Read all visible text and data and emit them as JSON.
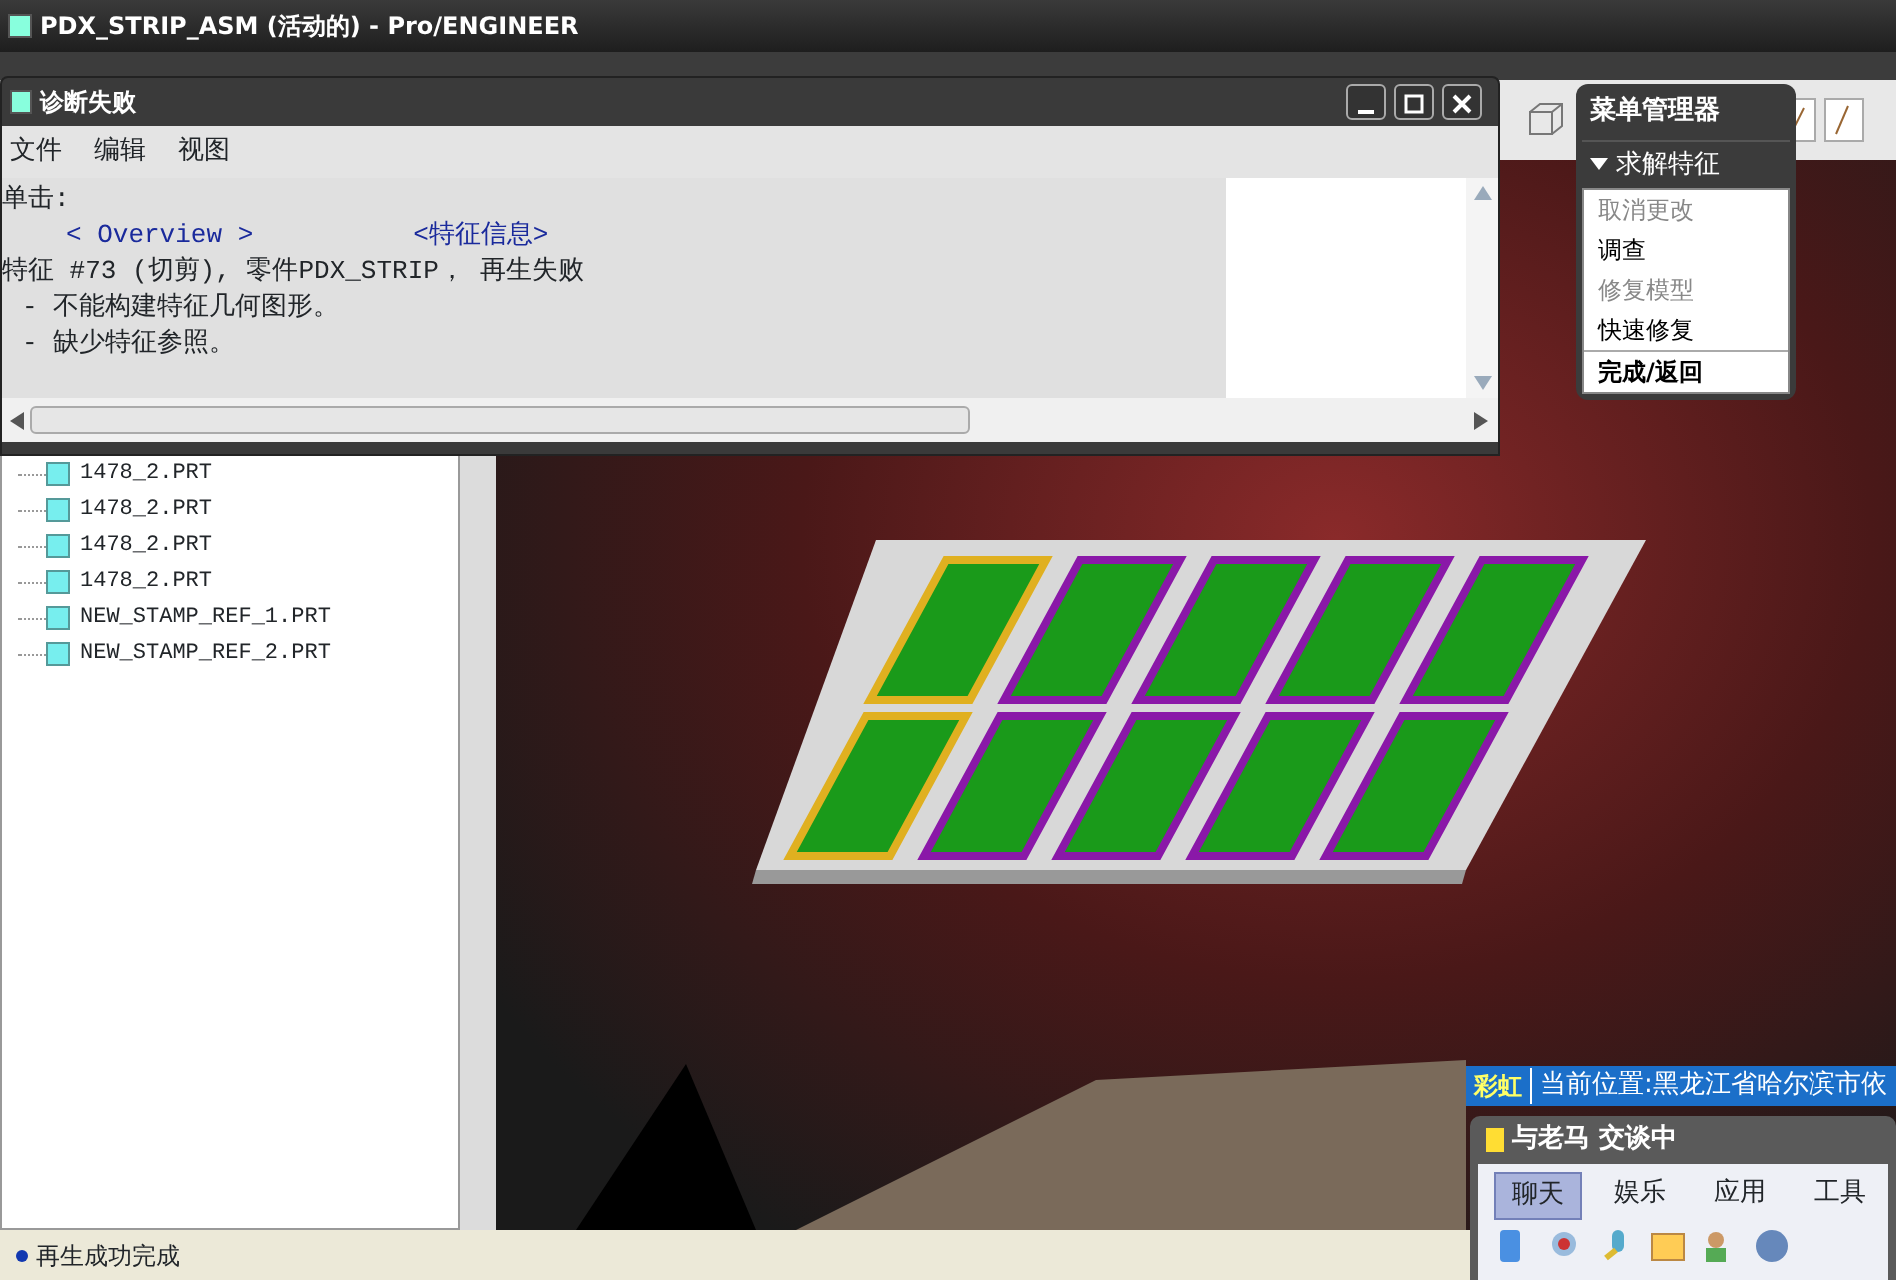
{
  "window": {
    "title": "PDX_STRIP_ASM (活动的) - Pro/ENGINEER"
  },
  "diagnostic_dialog": {
    "title": "诊断失败",
    "menu": [
      "文件",
      "编辑",
      "视图"
    ],
    "prompt": "单击:",
    "links": [
      "< Overview >",
      "<特征信息>"
    ],
    "message": "特征 #73 (切剪), 零件PDX_STRIP， 再生失败",
    "reasons": [
      "- 不能构建特征几何图形。",
      "- 缺少特征参照。"
    ]
  },
  "model_tree": {
    "items": [
      "1478_2.PRT",
      "1478_2.PRT",
      "1478_2.PRT",
      "1478_2.PRT",
      "NEW_STAMP_REF_1.PRT",
      "NEW_STAMP_REF_2.PRT"
    ]
  },
  "menu_manager": {
    "title": "菜单管理器",
    "section": "求解特征",
    "items": [
      {
        "label": "取消更改",
        "kind": "command",
        "disabled": true
      },
      {
        "label": "调查",
        "kind": "command",
        "disabled": false
      },
      {
        "label": "修复模型",
        "kind": "command",
        "disabled": true
      },
      {
        "label": "快速修复",
        "kind": "command",
        "disabled": false
      },
      {
        "label": "完成/返回",
        "kind": "done",
        "disabled": false
      }
    ]
  },
  "status_bar": {
    "message": "再生成功完成"
  },
  "location_bar": {
    "logo": "彩虹",
    "text": "当前位置:黑龙江省哈尔滨市依"
  },
  "chat_window": {
    "title": "与老马 交谈中",
    "tabs": [
      {
        "label": "聊天",
        "selected": true
      },
      {
        "label": "娱乐",
        "selected": false
      },
      {
        "label": "应用",
        "selected": false
      },
      {
        "label": "工具",
        "selected": false
      }
    ]
  }
}
